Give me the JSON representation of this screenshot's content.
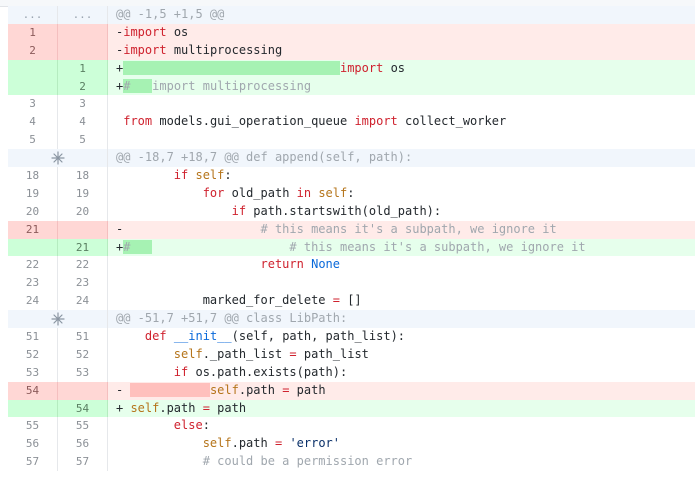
{
  "diff": {
    "rows": [
      {
        "type": "hunk",
        "old": "...",
        "new": "...",
        "segs": [
          {
            "t": "@@ -1,5 +1,5 @@",
            "c": "c"
          }
        ]
      },
      {
        "type": "del",
        "old": "1",
        "new": "",
        "segs": [
          {
            "t": "-"
          },
          {
            "t": "import",
            "c": "k"
          },
          {
            "t": " os"
          }
        ]
      },
      {
        "type": "del",
        "old": "2",
        "new": "",
        "segs": [
          {
            "t": "-"
          },
          {
            "t": "import",
            "c": "k"
          },
          {
            "t": " multiprocessing"
          }
        ]
      },
      {
        "type": "add",
        "old": "",
        "new": "1",
        "segs": [
          {
            "t": "+"
          },
          {
            "t": "                              ",
            "c": "hl-add"
          },
          {
            "t": "import",
            "c": "k"
          },
          {
            "t": " os"
          }
        ]
      },
      {
        "type": "add",
        "old": "",
        "new": "2",
        "segs": [
          {
            "t": "+"
          },
          {
            "t": "#   ",
            "c": "hl-add c"
          },
          {
            "t": "import multiprocessing",
            "c": "c"
          }
        ]
      },
      {
        "type": "ctx",
        "old": "3",
        "new": "3",
        "segs": [
          {
            "t": ""
          }
        ]
      },
      {
        "type": "ctx",
        "old": "4",
        "new": "4",
        "segs": [
          {
            "t": " "
          },
          {
            "t": "from",
            "c": "k"
          },
          {
            "t": " models.gui_operation_queue "
          },
          {
            "t": "import",
            "c": "k"
          },
          {
            "t": " collect_worker"
          }
        ]
      },
      {
        "type": "ctx",
        "old": "5",
        "new": "5",
        "segs": [
          {
            "t": ""
          }
        ]
      },
      {
        "type": "hunk",
        "old": "expand",
        "new": "",
        "segs": [
          {
            "t": "@@ -18,7 +18,7 @@ def append(self, path):",
            "c": "c"
          }
        ]
      },
      {
        "type": "ctx",
        "old": "18",
        "new": "18",
        "segs": [
          {
            "t": "        "
          },
          {
            "t": "if",
            "c": "k"
          },
          {
            "t": " "
          },
          {
            "t": "self",
            "c": "self"
          },
          {
            "t": ":"
          }
        ]
      },
      {
        "type": "ctx",
        "old": "19",
        "new": "19",
        "segs": [
          {
            "t": "            "
          },
          {
            "t": "for",
            "c": "k"
          },
          {
            "t": " old_path "
          },
          {
            "t": "in",
            "c": "k"
          },
          {
            "t": " "
          },
          {
            "t": "self",
            "c": "self"
          },
          {
            "t": ":"
          }
        ]
      },
      {
        "type": "ctx",
        "old": "20",
        "new": "20",
        "segs": [
          {
            "t": "                "
          },
          {
            "t": "if",
            "c": "k"
          },
          {
            "t": " path.startswith(old_path):"
          }
        ]
      },
      {
        "type": "del",
        "old": "21",
        "new": "",
        "segs": [
          {
            "t": "-                   "
          },
          {
            "t": "# this means it's a subpath, we ignore it",
            "c": "c"
          }
        ]
      },
      {
        "type": "add",
        "old": "",
        "new": "21",
        "segs": [
          {
            "t": "+"
          },
          {
            "t": "#   ",
            "c": "hl-add c"
          },
          {
            "t": "                   # this means it's a subpath, we ignore it",
            "c": "c"
          }
        ]
      },
      {
        "type": "ctx",
        "old": "22",
        "new": "22",
        "segs": [
          {
            "t": "                    "
          },
          {
            "t": "return",
            "c": "k"
          },
          {
            "t": " "
          },
          {
            "t": "None",
            "c": "n"
          }
        ]
      },
      {
        "type": "ctx",
        "old": "23",
        "new": "23",
        "segs": [
          {
            "t": ""
          }
        ]
      },
      {
        "type": "ctx",
        "old": "24",
        "new": "24",
        "segs": [
          {
            "t": "            marked_for_delete "
          },
          {
            "t": "=",
            "c": "o"
          },
          {
            "t": " []"
          }
        ]
      },
      {
        "type": "hunk",
        "old": "expand",
        "new": "",
        "segs": [
          {
            "t": "@@ -51,7 +51,7 @@ class LibPath:",
            "c": "c"
          }
        ]
      },
      {
        "type": "ctx",
        "old": "51",
        "new": "51",
        "segs": [
          {
            "t": "    "
          },
          {
            "t": "def",
            "c": "k"
          },
          {
            "t": " "
          },
          {
            "t": "__init__",
            "c": "n"
          },
          {
            "t": "(self, path, path_list):"
          }
        ]
      },
      {
        "type": "ctx",
        "old": "52",
        "new": "52",
        "segs": [
          {
            "t": "        "
          },
          {
            "t": "self",
            "c": "self"
          },
          {
            "t": "._path_list "
          },
          {
            "t": "=",
            "c": "o"
          },
          {
            "t": " path_list"
          }
        ]
      },
      {
        "type": "ctx",
        "old": "53",
        "new": "53",
        "segs": [
          {
            "t": "        "
          },
          {
            "t": "if",
            "c": "k"
          },
          {
            "t": " os.path.exists(path):"
          }
        ]
      },
      {
        "type": "del",
        "old": "54",
        "new": "",
        "segs": [
          {
            "t": "- "
          },
          {
            "t": "           ",
            "c": "hl-del"
          },
          {
            "t": "self",
            "c": "self"
          },
          {
            "t": ".path "
          },
          {
            "t": "=",
            "c": "o"
          },
          {
            "t": " path"
          }
        ]
      },
      {
        "type": "add",
        "old": "",
        "new": "54",
        "segs": [
          {
            "t": "+ "
          },
          {
            "t": "self",
            "c": "self"
          },
          {
            "t": ".path "
          },
          {
            "t": "=",
            "c": "o"
          },
          {
            "t": " path"
          }
        ]
      },
      {
        "type": "ctx",
        "old": "55",
        "new": "55",
        "segs": [
          {
            "t": "        "
          },
          {
            "t": "else",
            "c": "k"
          },
          {
            "t": ":"
          }
        ]
      },
      {
        "type": "ctx",
        "old": "56",
        "new": "56",
        "segs": [
          {
            "t": "            "
          },
          {
            "t": "self",
            "c": "self"
          },
          {
            "t": ".path "
          },
          {
            "t": "=",
            "c": "o"
          },
          {
            "t": " "
          },
          {
            "t": "'error'",
            "c": "s"
          }
        ]
      },
      {
        "type": "ctx",
        "old": "57",
        "new": "57",
        "segs": [
          {
            "t": "            "
          },
          {
            "t": "# could be a permission error",
            "c": "c"
          }
        ]
      }
    ]
  }
}
